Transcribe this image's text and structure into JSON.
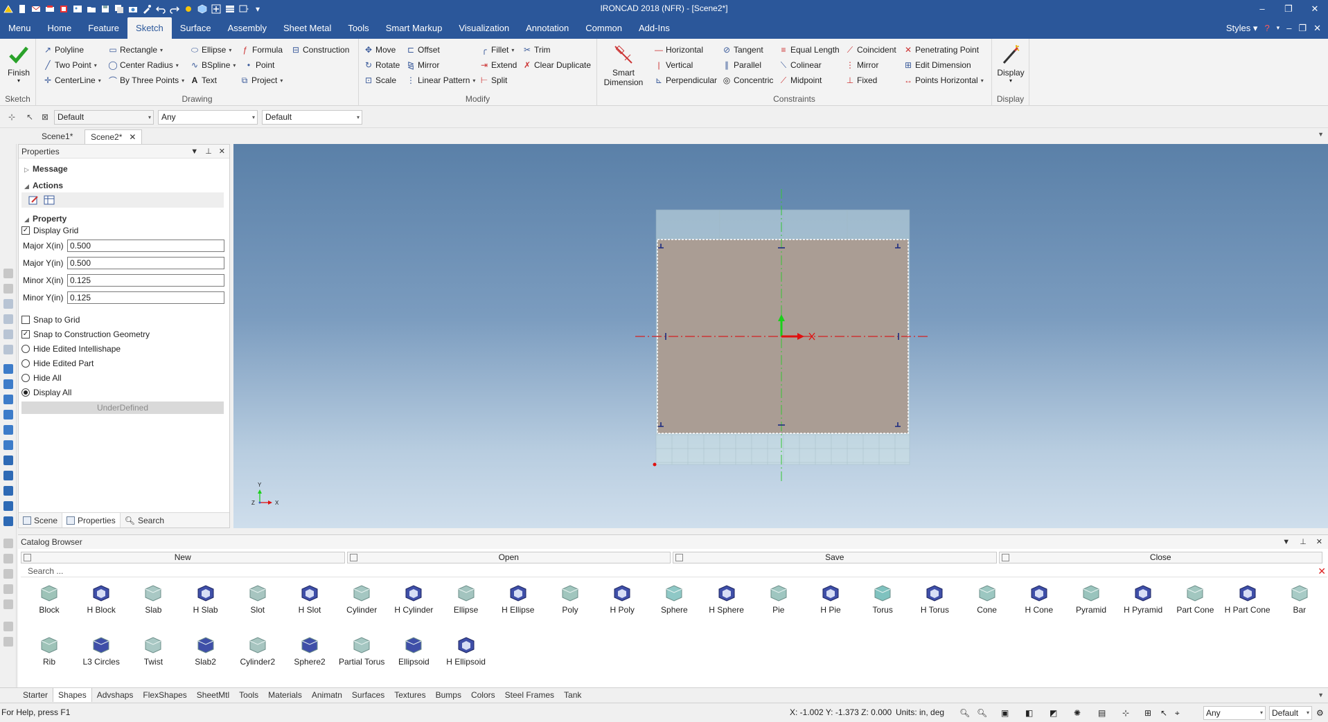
{
  "titlebar": {
    "title": "IRONCAD 2018 (NFR) - [Scene2*]",
    "qat_icons": [
      "app-logo-icon",
      "new-icon",
      "mail-icon",
      "print-icon",
      "export-icon",
      "image-icon",
      "open-folder-icon",
      "save-icon",
      "save-all-icon",
      "camera-icon",
      "tool-icon",
      "undo-icon",
      "redo-icon",
      "sun-icon",
      "cube-icon",
      "plus-icon",
      "grid-icon",
      "window-icon",
      "customize-icon"
    ]
  },
  "menu": {
    "tabs": [
      "Menu",
      "Home",
      "Feature",
      "Sketch",
      "Surface",
      "Assembly",
      "Sheet Metal",
      "Tools",
      "Smart Markup",
      "Visualization",
      "Annotation",
      "Common",
      "Add-Ins"
    ],
    "active": "Sketch",
    "styles_label": "Styles"
  },
  "ribbon": {
    "sketch_group": {
      "finish": "Finish",
      "label": "Sketch"
    },
    "drawing_group": {
      "label": "Drawing",
      "items": [
        "Polyline",
        "Rectangle",
        "Ellipse",
        "Formula",
        "Construction",
        "Two Point",
        "Center Radius",
        "BSpline",
        "Point",
        "CenterLine",
        "By Three Points",
        "Text",
        "Project"
      ]
    },
    "modify_group": {
      "label": "Modify",
      "items": [
        "Move",
        "Offset",
        "Fillet",
        "Trim",
        "Rotate",
        "Mirror",
        "Extend",
        "Clear Duplicate",
        "Scale",
        "Linear Pattern",
        "Split"
      ]
    },
    "constraints_group": {
      "label": "Constraints",
      "smart_dimension": "Smart Dimension",
      "items": [
        "Horizontal",
        "Tangent",
        "Equal Length",
        "Coincident",
        "Penetrating Point",
        "Vertical",
        "Parallel",
        "Colinear",
        "Mirror",
        "Edit Dimension",
        "Perpendicular",
        "Concentric",
        "Midpoint",
        "Fixed",
        "Points Horizontal"
      ]
    },
    "display_group": {
      "label": "Display",
      "button": "Display"
    }
  },
  "selection_bar": {
    "field1": "Default",
    "field2": "Any",
    "field3": "Default"
  },
  "doc_tabs": {
    "tabs": [
      "Scene1*",
      "Scene2*"
    ],
    "active": "Scene2*"
  },
  "properties": {
    "title": "Properties",
    "sections": {
      "message": "Message",
      "actions": "Actions",
      "property": "Property"
    },
    "display_grid": {
      "label": "Display Grid",
      "checked": true
    },
    "fields": [
      {
        "label": "Major X(in)",
        "value": "0.500"
      },
      {
        "label": "Major Y(in)",
        "value": "0.500"
      },
      {
        "label": "Minor X(in)",
        "value": "0.125"
      },
      {
        "label": "Minor Y(in)",
        "value": "0.125"
      }
    ],
    "snap_to_grid": {
      "label": "Snap to Grid",
      "checked": false
    },
    "snap_construction": {
      "label": "Snap to Construction Geometry",
      "checked": true
    },
    "radios": [
      {
        "label": "Hide Edited Intellishape",
        "selected": false
      },
      {
        "label": "Hide Edited Part",
        "selected": false
      },
      {
        "label": "Hide All",
        "selected": false
      },
      {
        "label": "Display All",
        "selected": true
      }
    ],
    "status": "UnderDefined",
    "footer_tabs": [
      "Scene",
      "Properties",
      "Search"
    ],
    "active_footer": "Properties"
  },
  "viewport": {
    "axis": {
      "y": "Y",
      "x": "X",
      "z": "Z"
    }
  },
  "catalog": {
    "title": "Catalog Browser",
    "buttons": [
      "New",
      "Open",
      "Save",
      "Close"
    ],
    "search_placeholder": "Search ...",
    "row1": [
      "Block",
      "H Block",
      "Slab",
      "H Slab",
      "Slot",
      "H Slot",
      "Cylinder",
      "H Cylinder",
      "Ellipse",
      "H Ellipse",
      "Poly",
      "H Poly",
      "Sphere",
      "H Sphere",
      "Pie",
      "H Pie",
      "Torus",
      "H Torus",
      "Cone",
      "H Cone",
      "Pyramid",
      "H Pyramid",
      "Part Cone",
      "H Part Cone",
      "Bar"
    ],
    "row2": [
      "Rib",
      "L3 Circles",
      "Twist",
      "Slab2",
      "Cylinder2",
      "Sphere2",
      "Partial Torus",
      "Ellipsoid",
      "H Ellipsoid"
    ],
    "tabs": [
      "Starter",
      "Shapes",
      "Advshaps",
      "FlexShapes",
      "SheetMtl",
      "Tools",
      "Materials",
      "Animatn",
      "Surfaces",
      "Textures",
      "Bumps",
      "Colors",
      "Steel Frames",
      "Tank"
    ],
    "active_tab": "Shapes"
  },
  "status": {
    "help": "For Help, press F1",
    "coords": "X: -1.002 Y: -1.373 Z: 0.000",
    "units": "Units: in, deg",
    "sel1": "Any",
    "sel2": "Default"
  },
  "colors": {
    "titlebar": "#2b579a",
    "accent": "#2b579a",
    "sketch_fill": "#aa9d94"
  }
}
